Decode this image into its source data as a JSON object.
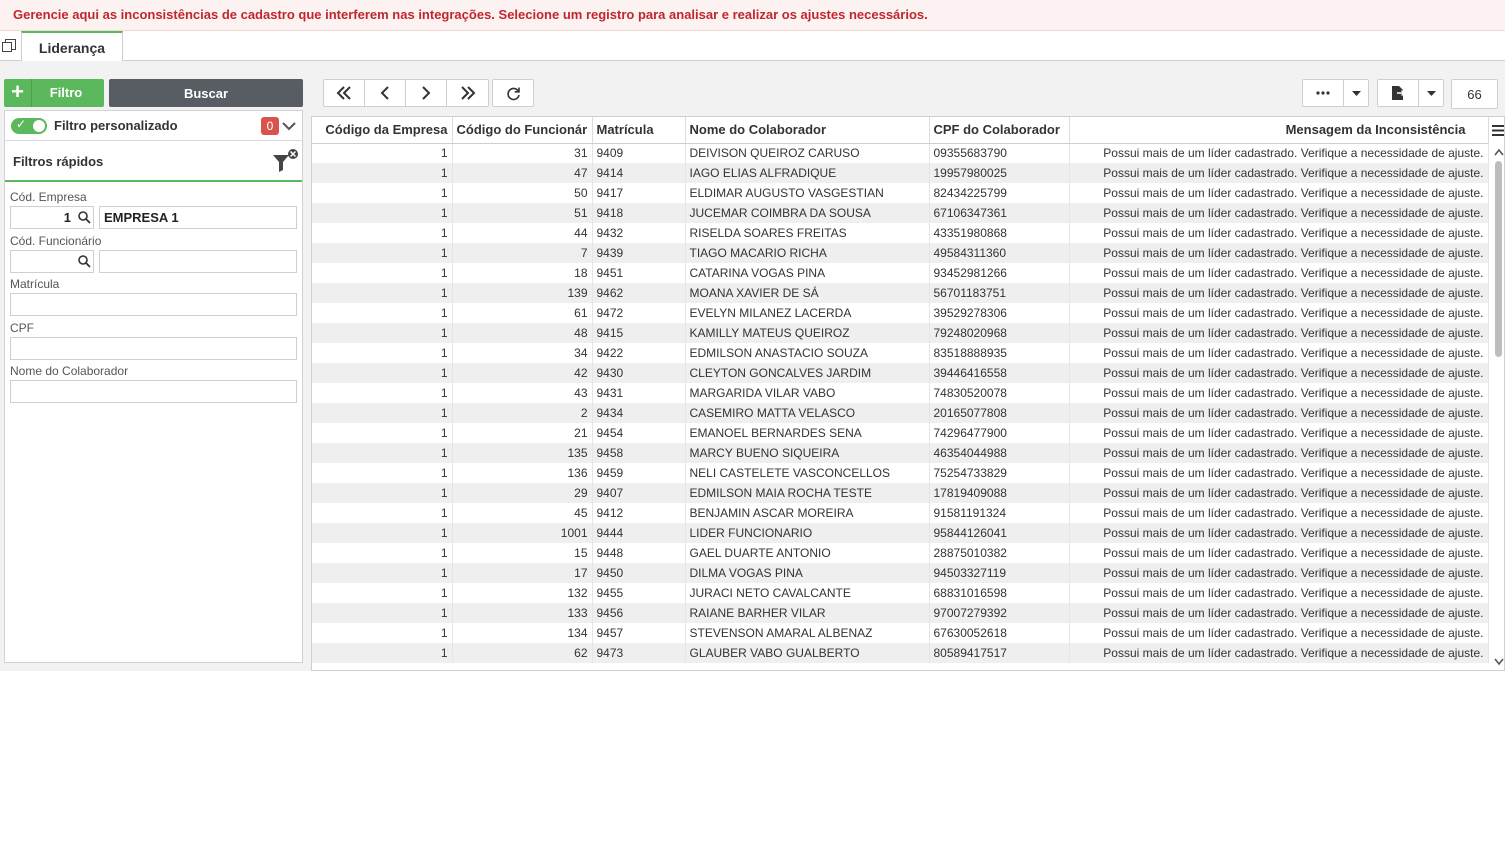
{
  "banner": {
    "text": "Gerencie aqui as inconsistências de cadastro que interferem nas integrações. Selecione um registro para analisar e realizar os ajustes necessários."
  },
  "tabs": [
    {
      "label": "Liderança",
      "active": true
    }
  ],
  "toolbar": {
    "filter_button": "Filtro",
    "search_button": "Buscar",
    "record_count": "66",
    "accent_color": "#5cb85c"
  },
  "filter_panel": {
    "custom_filter_label": "Filtro personalizado",
    "custom_filter_count": "0",
    "quick_filters_title": "Filtros rápidos",
    "fields": {
      "empresa": {
        "label": "Cód. Empresa",
        "code": "1",
        "name": "EMPRESA 1"
      },
      "funcionario": {
        "label": "Cód. Funcionário",
        "code": "",
        "name": ""
      },
      "matricula": {
        "label": "Matrícula",
        "value": ""
      },
      "cpf": {
        "label": "CPF",
        "value": ""
      },
      "nome": {
        "label": "Nome do Colaborador",
        "value": ""
      }
    }
  },
  "grid": {
    "columns": [
      "Código da Empresa",
      "Código do Funcionár",
      "Matrícula",
      "Nome do Colaborador",
      "CPF do Colaborador",
      "Mensagem da Inconsistência"
    ],
    "message": "Possui mais de um líder cadastrado. Verifique a necessidade de ajuste.",
    "rows": [
      [
        "1",
        "31",
        "9409",
        "DEIVISON QUEIROZ CARUSO",
        "09355683790"
      ],
      [
        "1",
        "47",
        "9414",
        "IAGO ELIAS ALFRADIQUE",
        "19957980025"
      ],
      [
        "1",
        "50",
        "9417",
        "ELDIMAR AUGUSTO VASGESTIAN",
        "82434225799"
      ],
      [
        "1",
        "51",
        "9418",
        "JUCEMAR COIMBRA DA SOUSA",
        "67106347361"
      ],
      [
        "1",
        "44",
        "9432",
        "RISELDA SOARES FREITAS",
        "43351980868"
      ],
      [
        "1",
        "7",
        "9439",
        "TIAGO MACARIO RICHA",
        "49584311360"
      ],
      [
        "1",
        "18",
        "9451",
        "CATARINA VOGAS PINA",
        "93452981266"
      ],
      [
        "1",
        "139",
        "9462",
        "MOANA XAVIER DE SÁ",
        "56701183751"
      ],
      [
        "1",
        "61",
        "9472",
        "EVELYN MILANEZ LACERDA",
        "39529278306"
      ],
      [
        "1",
        "48",
        "9415",
        "KAMILLY MATEUS QUEIROZ",
        "79248020968"
      ],
      [
        "1",
        "34",
        "9422",
        "EDMILSON ANASTACIO SOUZA",
        "83518888935"
      ],
      [
        "1",
        "42",
        "9430",
        "CLEYTON GONCALVES JARDIM",
        "39446416558"
      ],
      [
        "1",
        "43",
        "9431",
        "MARGARIDA VILAR VABO",
        "74830520078"
      ],
      [
        "1",
        "2",
        "9434",
        "CASEMIRO MATTA VELASCO",
        "20165077808"
      ],
      [
        "1",
        "21",
        "9454",
        "EMANOEL BERNARDES SENA",
        "74296477900"
      ],
      [
        "1",
        "135",
        "9458",
        "MARCY BUENO SIQUEIRA",
        "46354044988"
      ],
      [
        "1",
        "136",
        "9459",
        "NELI CASTELETE VASCONCELLOS",
        "75254733829"
      ],
      [
        "1",
        "29",
        "9407",
        "EDMILSON MAIA ROCHA TESTE",
        "17819409088"
      ],
      [
        "1",
        "45",
        "9412",
        "BENJAMIN ASCAR MOREIRA",
        "91581191324"
      ],
      [
        "1",
        "1001",
        "9444",
        "LIDER FUNCIONARIO",
        "95844126041"
      ],
      [
        "1",
        "15",
        "9448",
        "GAEL DUARTE ANTONIO",
        "28875010382"
      ],
      [
        "1",
        "17",
        "9450",
        "DILMA VOGAS PINA",
        "94503327119"
      ],
      [
        "1",
        "132",
        "9455",
        "JURACI NETO CAVALCANTE",
        "68831016598"
      ],
      [
        "1",
        "133",
        "9456",
        "RAIANE BARHER VILAR",
        "97007279392"
      ],
      [
        "1",
        "134",
        "9457",
        "STEVENSON AMARAL ALBENAZ",
        "67630052618"
      ],
      [
        "1",
        "62",
        "9473",
        "GLAUBER VABO GUALBERTO",
        "80589417517"
      ]
    ]
  }
}
